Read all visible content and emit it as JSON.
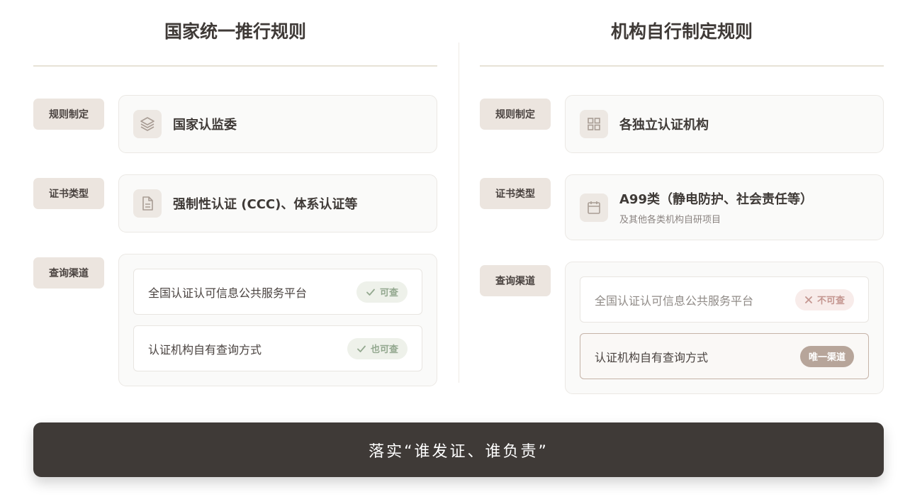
{
  "left": {
    "title": "国家统一推行规则",
    "rule": {
      "tag": "规则制定",
      "value": "国家认监委",
      "icon": "layers-icon"
    },
    "cert": {
      "tag": "证书类型",
      "value": "强制性认证 (CCC)、体系认证等",
      "icon": "document-icon"
    },
    "query": {
      "tag": "查询渠道",
      "channels": [
        {
          "label": "全国认证认可信息公共服务平台",
          "badge": "可查",
          "badge_icon": "check-icon"
        },
        {
          "label": "认证机构自有查询方式",
          "badge": "也可查",
          "badge_icon": "check-icon"
        }
      ]
    }
  },
  "right": {
    "title": "机构自行制定规则",
    "rule": {
      "tag": "规则制定",
      "value": "各独立认证机构",
      "icon": "grid-icon"
    },
    "cert": {
      "tag": "证书类型",
      "value": "A99类（静电防护、社会责任等）",
      "sub": "及其他各类机构自研项目",
      "icon": "calendar-icon"
    },
    "query": {
      "tag": "查询渠道",
      "channels": [
        {
          "label": "全国认证认可信息公共服务平台",
          "badge": "不可查",
          "badge_icon": "cross-icon"
        },
        {
          "label": "认证机构自有查询方式",
          "badge": "唯一渠道"
        }
      ]
    }
  },
  "footer": {
    "text": "落实“谁发证、谁负责”"
  },
  "colors": {
    "dark": "#3f3a37",
    "tag_bg": "#ece5df",
    "ok": "#93a88f",
    "no": "#c49690",
    "accent": "#b7a59a"
  }
}
